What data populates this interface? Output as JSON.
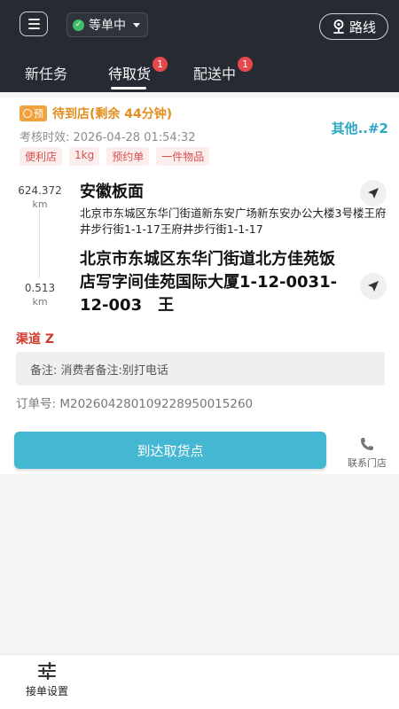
{
  "header": {
    "status_label": "等单中",
    "route_label": "路线",
    "tabs": [
      {
        "label": "新任务",
        "badge": ""
      },
      {
        "label": "待取货",
        "badge": "1"
      },
      {
        "label": "配送中",
        "badge": "1"
      }
    ]
  },
  "order": {
    "pre_tag": "预",
    "wait_text": "待到店(剩余 44分钟)",
    "other_label": "其他..#2",
    "audit_label": "考核时效: 2026-04-28 01:54:32",
    "tags": [
      "便利店",
      "1kg",
      "预约单",
      "一件物品"
    ],
    "shop": {
      "distance": "624.372",
      "unit": "km",
      "name": "安徽板面",
      "address": "北京市东城区东华门街道新东安广场新东安办公大楼3号楼王府井步行街1-1-17王府井步行街1-1-17"
    },
    "customer": {
      "distance": "0.513",
      "unit": "km",
      "address": "北京市东城区东华门街道北方佳苑饭店写字间佳苑国际大厦1-12-0031-12-003　王"
    },
    "channel": "渠道 Z",
    "remark": "备注: 消费者备注:别打电话",
    "order_no": "订单号: M202604280109228950015260",
    "arrive_button": "到达取货点",
    "contact_label": "联系门店"
  },
  "bottom": {
    "settings_label": "接单设置"
  },
  "colors": {
    "header_bg": "#262a33",
    "accent": "#44b7d2",
    "warning": "#e38e1f",
    "badge": "#e8474c",
    "channel": "#d33b2f"
  }
}
